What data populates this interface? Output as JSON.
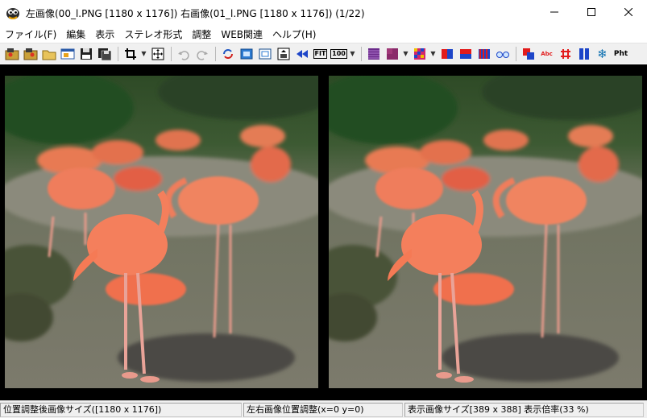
{
  "window": {
    "title": "左画像(00_l.PNG [1180 x 1176]) 右画像(01_l.PNG [1180 x 1176])  (1/22)",
    "icon": "app-icon",
    "controls": [
      "minimize-icon",
      "maximize-icon",
      "close-icon"
    ]
  },
  "menu": {
    "items": [
      "ファイル(F)",
      "編集",
      "表示",
      "ステレオ形式",
      "調整",
      "WEB関連",
      "ヘルプ(H)"
    ]
  },
  "toolbar": {
    "fit_label": "FIT",
    "zoom100_label": "100",
    "ruby_label": "Abc",
    "pht_label": "Pht",
    "colors": {
      "red": "#e21b1b",
      "blue": "#1d45c8",
      "purple": "#6b2a8a",
      "navy": "#1c2a7a",
      "teal": "#0b6fb0"
    }
  },
  "status": {
    "adjusted_size": "位置調整後画像サイズ([1180 x 1176])",
    "lr_offset": "左右画像位置調整(x=0 y=0)",
    "display_info": "表示画像サイズ[389 x 388]  表示倍率(33 %)"
  }
}
